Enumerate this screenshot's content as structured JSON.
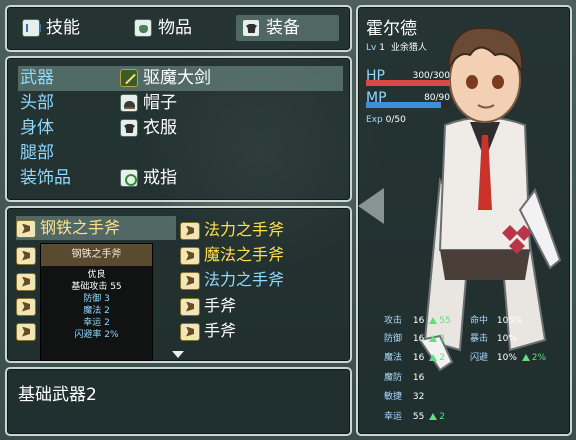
{
  "tabs": [
    {
      "label": "技能",
      "icon": "skill-book-icon"
    },
    {
      "label": "物品",
      "icon": "item-bag-icon"
    },
    {
      "label": "装备",
      "icon": "equip-shirt-icon"
    }
  ],
  "equip_slots": [
    {
      "slot": "武器",
      "item": "驱魔大剑",
      "icon": "sword-icon"
    },
    {
      "slot": "头部",
      "item": "帽子",
      "icon": "hat-icon"
    },
    {
      "slot": "身体",
      "item": "衣服",
      "icon": "shirt-icon"
    },
    {
      "slot": "腿部",
      "item": "",
      "icon": ""
    },
    {
      "slot": "装饰品",
      "item": "戒指",
      "icon": "ring-icon"
    }
  ],
  "inventory_left": [
    "钢铁之手斧",
    "",
    "",
    "",
    ""
  ],
  "inventory_right": [
    "法力之手斧",
    "魔法之手斧",
    "法力之手斧",
    "手斧",
    "手斧"
  ],
  "tooltip": {
    "title": "钢铁之手斧",
    "quality": "优良",
    "base_attack": "基础攻击 55",
    "lines": [
      "防御 3",
      "魔法 2",
      "幸运 2",
      "闪避率 2%"
    ]
  },
  "description": "基础武器2",
  "character": {
    "name": "霍尔德",
    "level_label": "Lv",
    "level": "1",
    "class": "业余猎人",
    "hp_label": "HP",
    "hp": "300/300",
    "hp_fill": 1.0,
    "mp_label": "MP",
    "mp": "80/90",
    "mp_fill": 0.89,
    "exp_label": "Exp",
    "exp": "0/50"
  },
  "stats_left": [
    {
      "label": "攻击",
      "base": "16",
      "bonus": "55"
    },
    {
      "label": "防御",
      "base": "16",
      "bonus": "3"
    },
    {
      "label": "魔法",
      "base": "16",
      "bonus": "2"
    },
    {
      "label": "魔防",
      "base": "16",
      "bonus": ""
    },
    {
      "label": "敏捷",
      "base": "32",
      "bonus": ""
    },
    {
      "label": "幸运",
      "base": "55",
      "bonus": "2"
    }
  ],
  "stats_right": [
    {
      "label": "命中",
      "base": "105%",
      "bonus": ""
    },
    {
      "label": "暴击",
      "base": "10%",
      "bonus": ""
    },
    {
      "label": "闪避",
      "base": "10%",
      "bonus": "2%"
    }
  ],
  "colors": {
    "hp": "#d84a4a",
    "mp": "#3f8fd8",
    "category": "#8fd8ff",
    "selected_item": "#ffe08a",
    "item_name": "#ffe04a",
    "stat_label": "#a8d8ff",
    "bonus": "#5fe07a"
  }
}
